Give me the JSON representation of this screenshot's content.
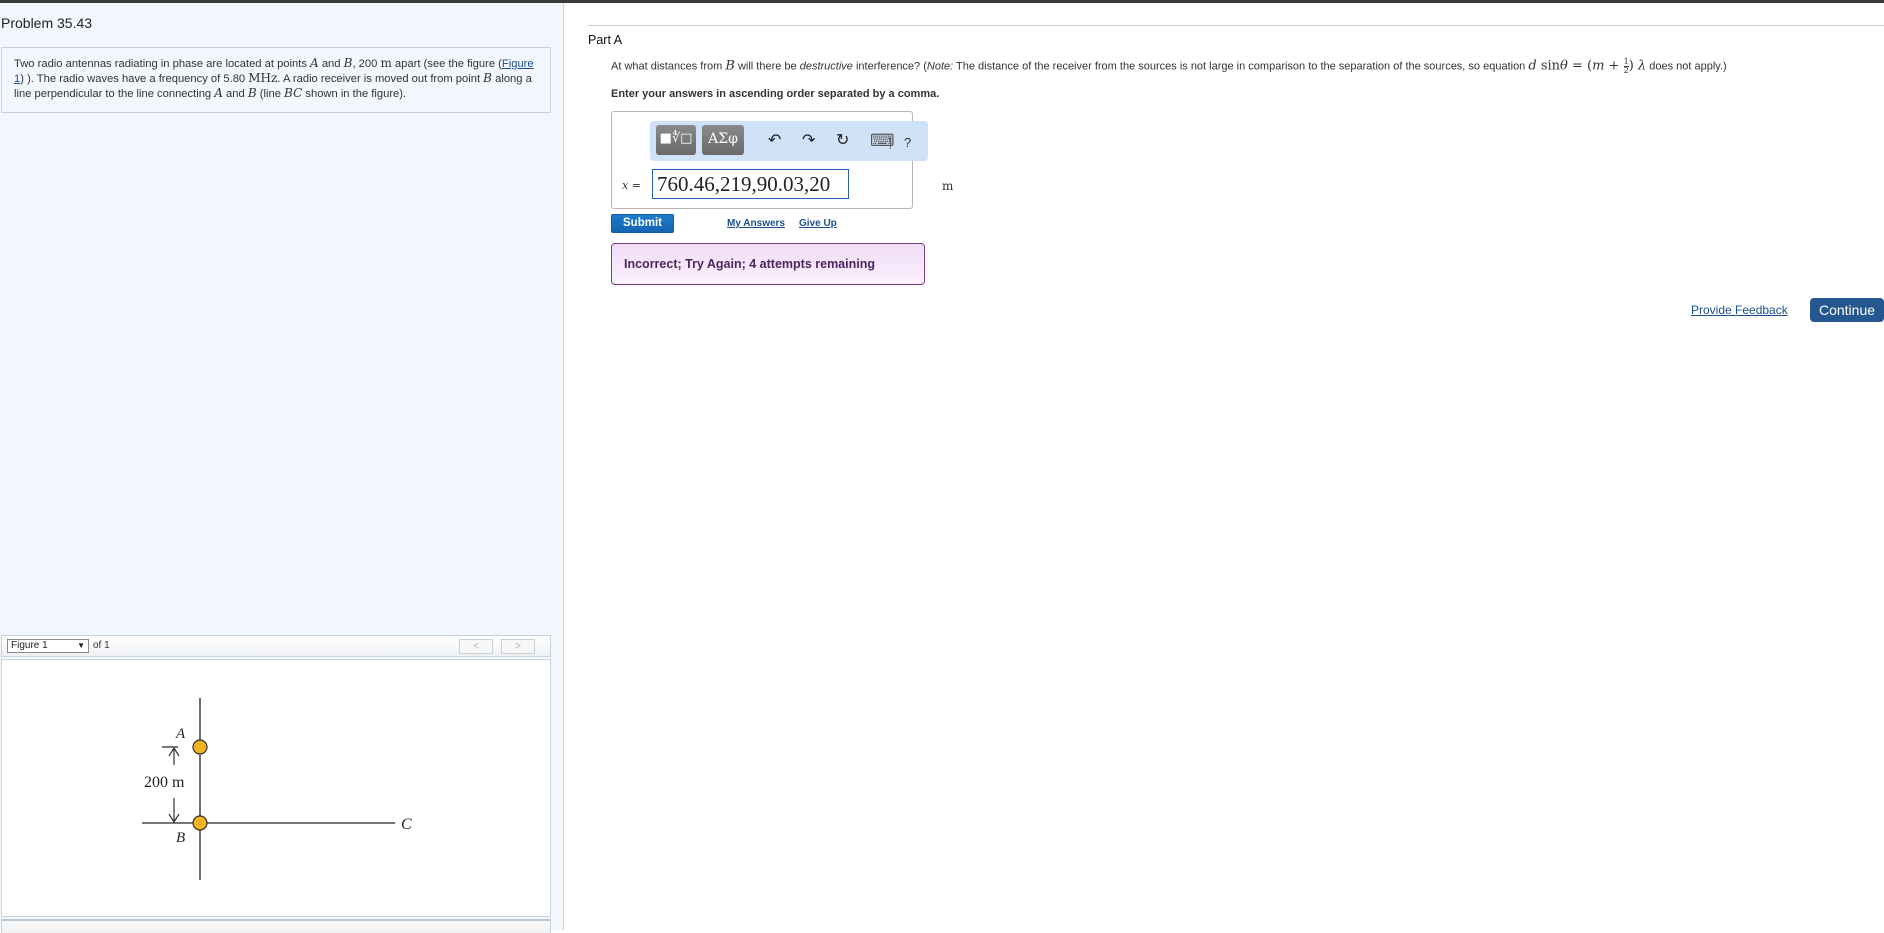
{
  "problem": {
    "title": "Problem 35.43",
    "text_parts": {
      "p1": "Two radio antennas radiating in phase are located at points ",
      "A": "A",
      "and1": " and ",
      "B": "B",
      "sep": ", 200 ",
      "m_unit": "m",
      "p2": " apart (see the figure (",
      "figure_link": "Figure 1",
      "p3": ") ). The radio waves have a frequency of 5.80 ",
      "mhz_unit": "MHz",
      "p4": ". A radio receiver is moved out from point ",
      "B2": "B",
      "p5": " along a line perpendicular to the line connecting ",
      "A2": "A",
      "and2": " and ",
      "B3": "B",
      "p6": " (line ",
      "BC": "BC",
      "p7": " shown in the figure)."
    }
  },
  "figure": {
    "select_value": "Figure 1",
    "of_label": "of 1",
    "prev_label": "<",
    "next_label": ">",
    "labels": {
      "A": "A",
      "B": "B",
      "C": "C",
      "distance": "200 m"
    },
    "colors": {
      "antenna": "#f2b321",
      "line": "#4a4a4a"
    }
  },
  "part": {
    "title": "Part A",
    "question": {
      "q1": "At what distances from ",
      "B": "B",
      "q2": " will there be ",
      "destructive": "destructive",
      "q3": " interference? (",
      "note": "Note:",
      "q4": " The distance of the receiver from the sources is not large in comparison to the separation of the sources, so equation ",
      "eq_d": "d",
      "eq_sin": " sin",
      "eq_theta": "θ",
      "eq_eq": " = (",
      "eq_m": "m",
      "eq_plus": " + ",
      "frac_num": "1",
      "frac_den": "2",
      "eq_close": ") ",
      "eq_lambda": "λ",
      "q5": " does not apply.)"
    },
    "instruction": "Enter your answers in ascending order separated by a comma.",
    "toolbar": {
      "templates_label": "■∜□",
      "symbols_label": "ΑΣφ",
      "undo": "↶",
      "redo": "↷",
      "reset": "↻",
      "keyboard": "⌨",
      "separator": "|",
      "help": "?"
    },
    "variable_label": "x",
    "equals": " =",
    "answer_value": "760.46,219,90.03,20",
    "unit": "m",
    "submit_label": "Submit",
    "my_answers_label": "My Answers",
    "give_up_label": "Give Up",
    "feedback_text": "Incorrect; Try Again; 4 attempts remaining"
  },
  "footer": {
    "provide_feedback_label": "Provide Feedback",
    "continue_label": "Continue"
  },
  "colors": {
    "accent": "#1565b0",
    "continue": "#24568f",
    "feedback_border": "#7a3d8f",
    "feedback_bg": "#f0dcf7",
    "toolbar_bg": "#cfe2f8",
    "pane_bg": "#f2f7fd"
  }
}
